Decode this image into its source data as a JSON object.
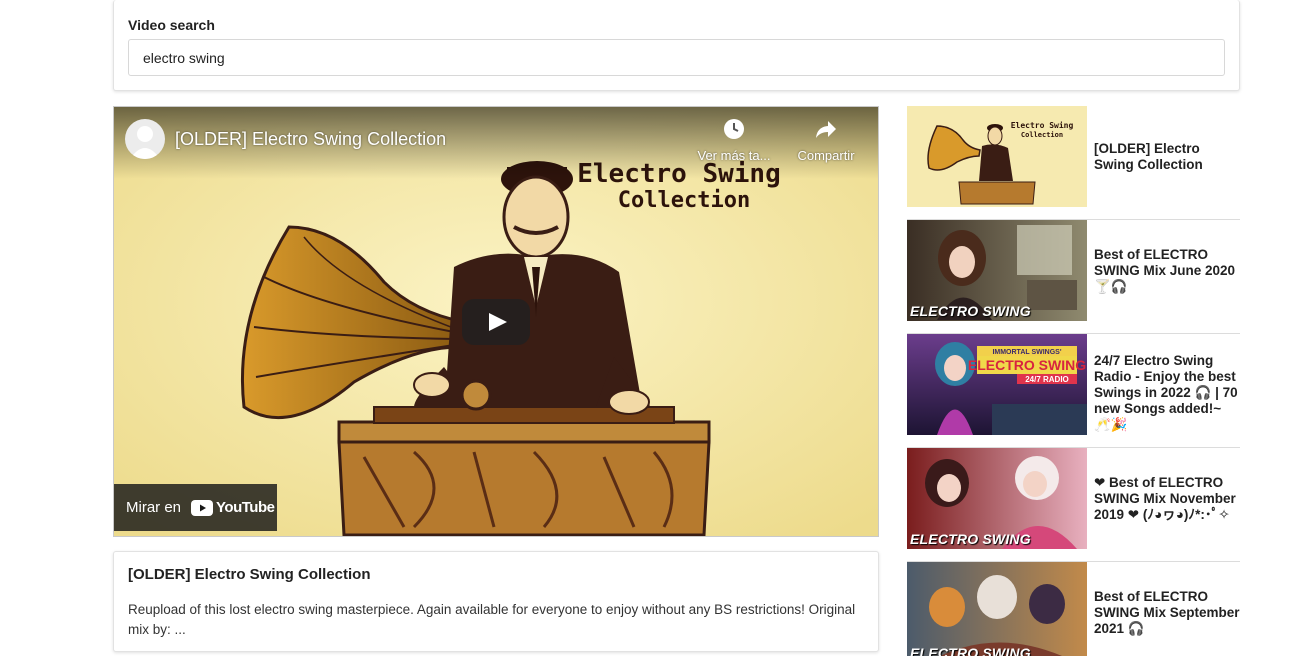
{
  "search": {
    "label": "Video search",
    "value": "electro swing"
  },
  "player": {
    "title": "[OLDER] Electro Swing Collection",
    "art_text_line1": "Electro Swing",
    "art_text_line2": "Collection",
    "watch_later_label": "Ver más ta...",
    "share_label": "Compartir",
    "watch_on_label": "Mirar en",
    "youtube_label": "YouTube"
  },
  "description": {
    "title": "[OLDER] Electro Swing Collection",
    "text": "Reupload of this lost electro swing masterpiece. Again available for everyone to enjoy without any BS restrictions! Original mix by: ..."
  },
  "videos": [
    {
      "title": "[OLDER] Electro Swing Collection",
      "thumb_text_line1": "Electro Swing",
      "thumb_text_line2": "Collection"
    },
    {
      "title": "Best of ELECTRO SWING Mix June 2020 🍸🎧",
      "thumb_caption": "ELECTRO SWING"
    },
    {
      "title": "24/7 Electro Swing Radio - Enjoy the best Swings in 2022 🎧 | 70 new Songs added!~ 🥂🎉",
      "thumb_banner_top": "IMMORTAL SWINGS'",
      "thumb_banner_main": "ELECTRO SWING",
      "thumb_banner_sub": "24/7 RADIO"
    },
    {
      "title": "❤ Best of ELECTRO SWING Mix November 2019 ❤ (ﾉ◕ヮ◕)ﾉ*:･ﾟ✧",
      "thumb_caption": "ELECTRO SWING"
    },
    {
      "title": "Best of ELECTRO SWING Mix September 2021 🎧",
      "thumb_caption": "ELECTRO SWING"
    }
  ],
  "colors": {
    "poster_bg": "#f2e7a8",
    "ink": "#3a1d14",
    "youtube_red": "#ff0000"
  }
}
